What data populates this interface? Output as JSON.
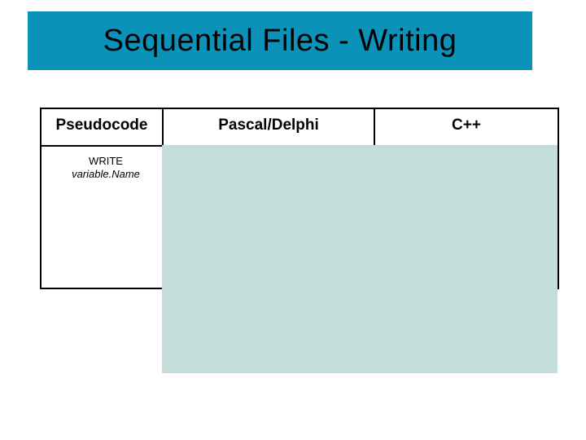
{
  "title": "Sequential Files - Writing",
  "columns": {
    "c1": "Pseudocode",
    "c2": "Pascal/Delphi",
    "c3": "C++"
  },
  "pseudocode": {
    "keyword": "WRITE",
    "variable": "variable.Name"
  }
}
